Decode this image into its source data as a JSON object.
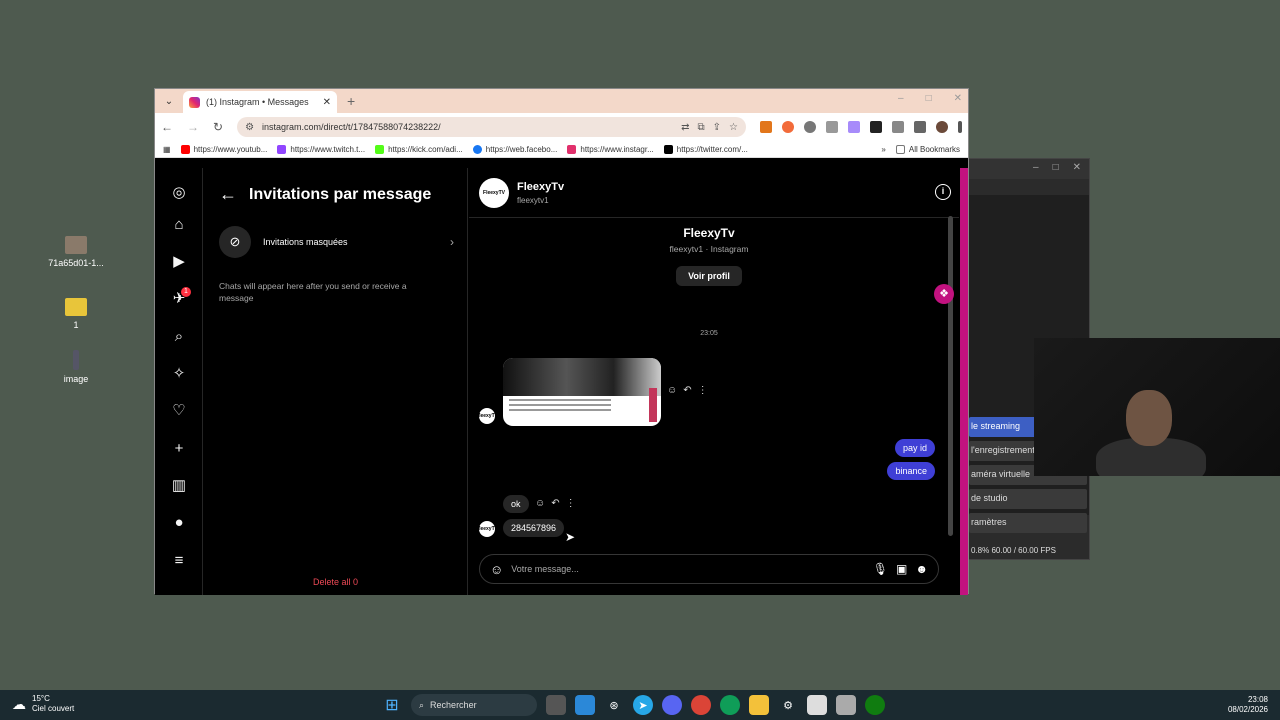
{
  "desktop": {
    "icons": [
      {
        "label": "71a65d01-1...",
        "icon": "photo-file-icon"
      },
      {
        "label": "1",
        "icon": "folder-icon"
      },
      {
        "label": "image",
        "icon": "image-file-icon"
      }
    ]
  },
  "obs": {
    "buttons": [
      "le streaming",
      "l'enregistrement",
      "améra virtuelle",
      "de studio",
      "ramètres"
    ],
    "status": "0.8%    60.00 / 60.00 FPS"
  },
  "browser": {
    "tab_title": "(1) Instagram • Messages",
    "url": "instagram.com/direct/t/17847588074238222/",
    "bookmarks": [
      {
        "label": "https://www.youtub...",
        "color": "#ff0000"
      },
      {
        "label": "https://www.twitch.t...",
        "color": "#9146ff"
      },
      {
        "label": "https://kick.com/adi...",
        "color": "#53fc18"
      },
      {
        "label": "https://web.facebo...",
        "color": "#1877f2"
      },
      {
        "label": "https://www.instagr...",
        "color": "#e1306c"
      },
      {
        "label": "https://twitter.com/...",
        "color": "#000000"
      }
    ],
    "all_bookmarks": "All Bookmarks"
  },
  "instagram": {
    "list_title": "Invitations par message",
    "hidden_requests": "Invitations masquées",
    "hint": "Chats will appear here after you send or receive a message",
    "delete_all": "Delete all 0",
    "nav_badge": "1",
    "chat": {
      "name": "FleexyTv",
      "username": "fleexytv1",
      "avatar_text": "FleexyTV",
      "profile_name": "FleexyTv",
      "profile_sub": "fleexytv1 · Instagram",
      "view_profile": "Voir profil",
      "timestamp": "23:05",
      "messages": [
        {
          "from": "them",
          "type": "image"
        },
        {
          "from": "me",
          "text": "pay id"
        },
        {
          "from": "me",
          "text": "binance"
        },
        {
          "from": "them",
          "text": "ok"
        },
        {
          "from": "them",
          "text": "284567896"
        }
      ],
      "composer_placeholder": "Votre message..."
    }
  },
  "taskbar": {
    "weather_temp": "15°C",
    "weather_desc": "Ciel couvert",
    "search": "Rechercher",
    "time": "23:08",
    "date": "08/02/2026"
  }
}
